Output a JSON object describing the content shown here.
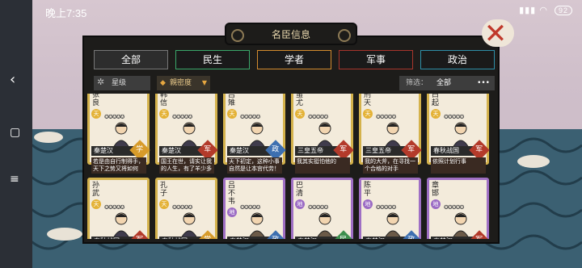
{
  "status": {
    "time": "晚上7:35",
    "battery": "92"
  },
  "panel": {
    "title": "名臣信息"
  },
  "tabs": [
    {
      "label": "全部",
      "color": "#7b7b7b",
      "active": true
    },
    {
      "label": "民生",
      "color": "#3aa86a"
    },
    {
      "label": "学者",
      "color": "#d38b2e"
    },
    {
      "label": "军事",
      "color": "#a8352c"
    },
    {
      "label": "政治",
      "color": "#2e8fa8"
    }
  ],
  "filters": {
    "star": "星级",
    "fav": "親密度",
    "screen_label": "筛选：",
    "screen_value": "全部",
    "more": "•••"
  },
  "cards": [
    {
      "name": "张良",
      "tier": "天",
      "tier_class": "sky",
      "faction": "秦楚汉",
      "type": "学",
      "type_class": "gold",
      "desc": "若是由自行制得手，天下之势又将如何",
      "frame": "gold"
    },
    {
      "name": "韩信",
      "tier": "天",
      "tier_class": "sky",
      "faction": "秦楚汉",
      "type": "军",
      "type_class": "red",
      "desc": "国王在世，请实让我的人生，有了羊少多",
      "frame": "gold"
    },
    {
      "name": "吕雉",
      "tier": "天",
      "tier_class": "sky",
      "faction": "秦楚汉",
      "type": "政",
      "type_class": "blue",
      "desc": "天下初定，这种小事自然是让本宫代劳！",
      "frame": "gold"
    },
    {
      "name": "蚩尤",
      "tier": "天",
      "tier_class": "sky",
      "faction": "三皇五帝",
      "type": "军",
      "type_class": "red",
      "desc": "我其实挺怕他的",
      "frame": "gold"
    },
    {
      "name": "刑天",
      "tier": "天",
      "tier_class": "sky",
      "faction": "三皇五帝",
      "type": "军",
      "type_class": "red",
      "desc": "我的大斧，在寻找一个合格的对手",
      "frame": "gold"
    },
    {
      "name": "白起",
      "tier": "天",
      "tier_class": "sky",
      "faction": "春秋战国",
      "type": "军",
      "type_class": "red",
      "desc": "依照计划行事",
      "frame": "gold"
    },
    {
      "name": "孙武",
      "tier": "天",
      "tier_class": "sky",
      "faction": "春秋战国",
      "type": "军",
      "type_class": "red",
      "desc": "",
      "frame": "gold"
    },
    {
      "name": "孔子",
      "tier": "天",
      "tier_class": "sky",
      "faction": "春秋战国",
      "type": "学",
      "type_class": "gold",
      "desc": "",
      "frame": "gold"
    },
    {
      "name": "吕不韦",
      "tier": "地",
      "tier_class": "earth",
      "faction": "秦楚汉",
      "type": "政",
      "type_class": "blue",
      "desc": "",
      "frame": "purple"
    },
    {
      "name": "巴清",
      "tier": "地",
      "tier_class": "earth",
      "faction": "秦楚汉",
      "type": "民",
      "type_class": "green",
      "desc": "",
      "frame": "purple"
    },
    {
      "name": "陈平",
      "tier": "地",
      "tier_class": "earth",
      "faction": "秦楚汉",
      "type": "政",
      "type_class": "blue",
      "desc": "",
      "frame": "purple"
    },
    {
      "name": "章邯",
      "tier": "地",
      "tier_class": "earth",
      "faction": "秦楚汉",
      "type": "军",
      "type_class": "red",
      "desc": "",
      "frame": "purple"
    }
  ]
}
